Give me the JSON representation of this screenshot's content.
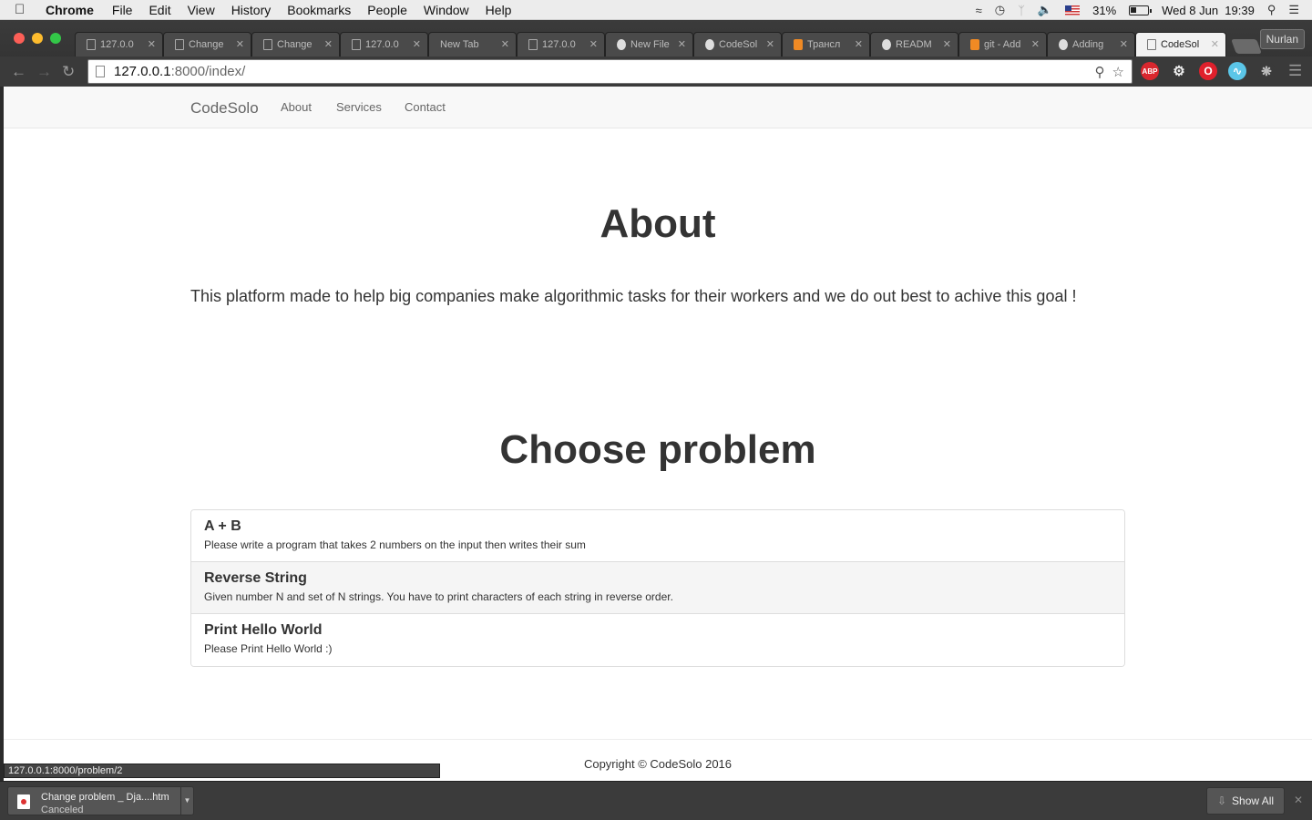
{
  "menubar": {
    "apple_icon": "apple-icon",
    "items": [
      "Chrome",
      "File",
      "Edit",
      "View",
      "History",
      "Bookmarks",
      "People",
      "Window",
      "Help"
    ],
    "battery": "31%",
    "datetime": "Wed 8 Jun  19:39"
  },
  "browser": {
    "tabs": [
      {
        "label": "127.0.0",
        "icon": "page"
      },
      {
        "label": "Change",
        "icon": "page"
      },
      {
        "label": "Change",
        "icon": "page"
      },
      {
        "label": "127.0.0",
        "icon": "page"
      },
      {
        "label": "New Tab",
        "icon": "none"
      },
      {
        "label": "127.0.0",
        "icon": "page"
      },
      {
        "label": "New File",
        "icon": "github"
      },
      {
        "label": "CodeSol",
        "icon": "github"
      },
      {
        "label": "Трансл",
        "icon": "orange"
      },
      {
        "label": "READM",
        "icon": "github"
      },
      {
        "label": "git - Add",
        "icon": "git"
      },
      {
        "label": "Adding",
        "icon": "github"
      },
      {
        "label": "CodeSol",
        "icon": "page",
        "active": true
      }
    ],
    "profile_name": "Nurlan",
    "url_host": "127.0.0.1",
    "url_rest": ":8000/index/",
    "extensions": [
      "ABP",
      "gear",
      "opera",
      "swirl",
      "puzzle"
    ]
  },
  "site": {
    "brand": "CodeSolo",
    "nav": [
      "About",
      "Services",
      "Contact"
    ],
    "about_heading": "About",
    "about_text": "This platform made to help big companies make algorithmic tasks for their workers and we do out best to achive this goal !",
    "choose_heading": "Choose problem",
    "problems": [
      {
        "title": "A + B",
        "description": "Please write a program that takes 2 numbers on the input then writes their sum"
      },
      {
        "title": "Reverse String",
        "description": "Given number N and set of N strings. You have to print characters of each string in reverse order."
      },
      {
        "title": "Print Hello World",
        "description": "Please Print Hello World :)"
      }
    ],
    "copyright": "Copyright © CodeSolo 2016"
  },
  "status_url": "127.0.0.1:8000/problem/2",
  "downloads": {
    "file_name": "Change problem _ Dja....htm",
    "file_status": "Canceled",
    "show_all": "Show All"
  }
}
